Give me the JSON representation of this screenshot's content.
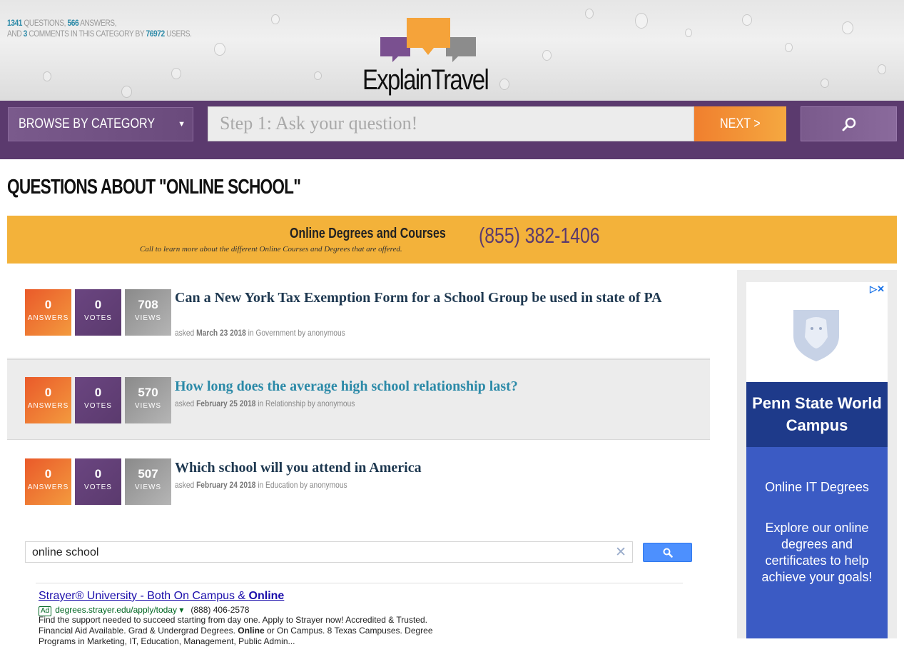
{
  "header": {
    "stats": {
      "questions": "1341",
      "questions_label": "QUESTIONS,",
      "answers": "566",
      "answers_label": "ANSWERS,",
      "and_label": "AND",
      "comments": "3",
      "comments_label": "COMMENTS IN THIS CATEGORY BY",
      "users": "76972",
      "users_label": "USERS."
    },
    "logo_text": "ExplainTravel",
    "colors": {
      "orange": "#f5a33a",
      "purple": "#7a5090",
      "gray": "#8c8c8c"
    }
  },
  "nav": {
    "browse_label": "BROWSE BY CATEGORY",
    "ask_placeholder": "Step 1: Ask your question!",
    "next_label": "NEXT >",
    "search_icon": "search-icon"
  },
  "page_title": "QUESTIONS ABOUT \"ONLINE SCHOOL\"",
  "banner": {
    "title": "Online Degrees and Courses",
    "subtitle": "Call to learn more about the different Online Courses and Degrees that are offered.",
    "phone": "(855) 382-1406"
  },
  "questions": [
    {
      "answers": "0",
      "answers_label": "ANSWERS",
      "votes": "0",
      "votes_label": "VOTES",
      "views": "708",
      "views_label": "VIEWS",
      "title": "Can a New York Tax Exemption Form for a School Group be used in state of PA",
      "asked": "asked",
      "date": "March 23 2018",
      "in": "in",
      "category": "Government",
      "by": "by anonymous"
    },
    {
      "answers": "0",
      "answers_label": "ANSWERS",
      "votes": "0",
      "votes_label": "VOTES",
      "views": "570",
      "views_label": "VIEWS",
      "title": "How long does the average high school relationship last?",
      "asked": "asked",
      "date": "February 25 2018",
      "in": "in",
      "category": "Relationship",
      "by": "by anonymous"
    },
    {
      "answers": "0",
      "answers_label": "ANSWERS",
      "votes": "0",
      "votes_label": "VOTES",
      "views": "507",
      "views_label": "VIEWS",
      "title": "Which school will you attend in America",
      "asked": "asked",
      "date": "February 24 2018",
      "in": "in",
      "category": "Education",
      "by": "by anonymous"
    }
  ],
  "search": {
    "value": "online school",
    "clear": "✕"
  },
  "text_ad": {
    "title_a": "Strayer® University - Both On Campus & ",
    "title_b": "Online",
    "tag": "Ad",
    "url": "degrees.strayer.edu/apply/today",
    "url_caret": "▾",
    "phone": "(888) 406-2578",
    "desc_1": "Find the support needed to succeed starting from day one. Apply to Strayer now! Accredited & Trusted.",
    "desc_2a": "Financial Aid Available. Grad & Undergrad Degrees. ",
    "desc_2b": "Online",
    "desc_2c": " or On Campus. 8 Texas Campuses. Degree",
    "desc_3": "Programs in Marketing, IT, Education, Management, Public Admin..."
  },
  "sidebar_ad": {
    "choices": "▷✕",
    "name": "Penn State World Campus",
    "line1": "Online IT Degrees",
    "line2": "Explore our online degrees and certificates to help achieve your goals!"
  }
}
